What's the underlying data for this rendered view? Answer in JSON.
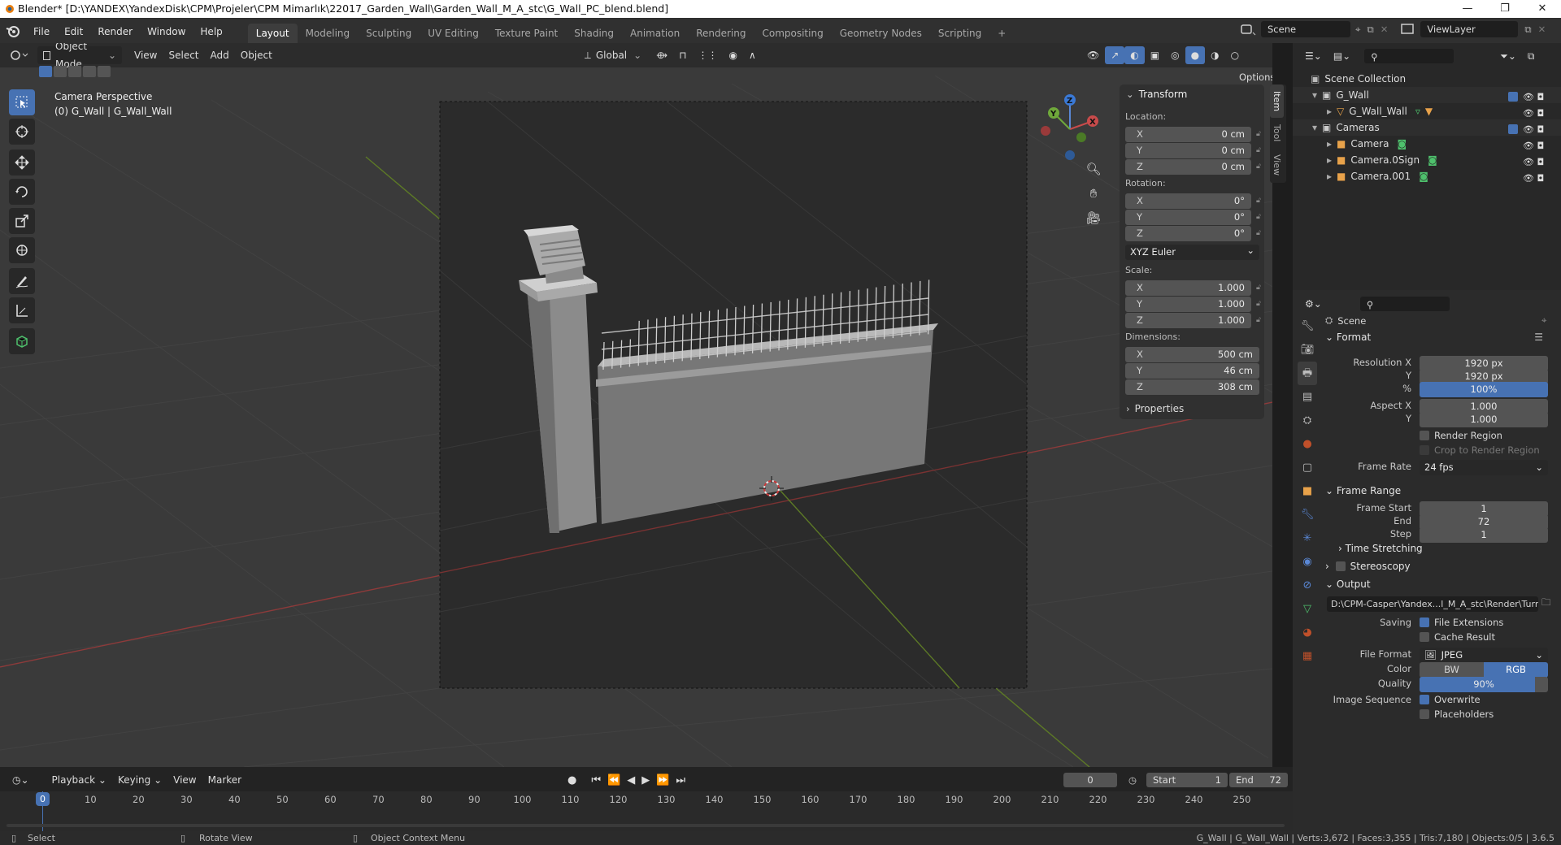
{
  "window": {
    "title": "Blender* [D:\\YANDEX\\YandexDisk\\CPM\\Projeler\\CPM Mimarlık\\22017_Garden_Wall\\Garden_Wall_M_A_stc\\G_Wall_PC_blend.blend]"
  },
  "menus": [
    "File",
    "Edit",
    "Render",
    "Window",
    "Help"
  ],
  "workspace_tabs": [
    "Layout",
    "Modeling",
    "Sculpting",
    "UV Editing",
    "Texture Paint",
    "Shading",
    "Animation",
    "Rendering",
    "Compositing",
    "Geometry Nodes",
    "Scripting"
  ],
  "active_tab": "Layout",
  "scene_name": "Scene",
  "view_layer": "ViewLayer",
  "viewport": {
    "mode": "Object Mode",
    "menus": [
      "View",
      "Select",
      "Add",
      "Object"
    ],
    "orientation": "Global",
    "options_label": "Options",
    "overlay_line1": "Camera Perspective",
    "overlay_line2": "(0) G_Wall | G_Wall_Wall"
  },
  "n_panel": {
    "header": "Transform",
    "location_label": "Location:",
    "location": [
      {
        "axis": "X",
        "value": "0 cm"
      },
      {
        "axis": "Y",
        "value": "0 cm"
      },
      {
        "axis": "Z",
        "value": "0 cm"
      }
    ],
    "rotation_label": "Rotation:",
    "rotation": [
      {
        "axis": "X",
        "value": "0°"
      },
      {
        "axis": "Y",
        "value": "0°"
      },
      {
        "axis": "Z",
        "value": "0°"
      }
    ],
    "rotation_mode": "XYZ Euler",
    "scale_label": "Scale:",
    "scale": [
      {
        "axis": "X",
        "value": "1.000"
      },
      {
        "axis": "Y",
        "value": "1.000"
      },
      {
        "axis": "Z",
        "value": "1.000"
      }
    ],
    "dimensions_label": "Dimensions:",
    "dimensions": [
      {
        "axis": "X",
        "value": "500 cm"
      },
      {
        "axis": "Y",
        "value": "46 cm"
      },
      {
        "axis": "Z",
        "value": "308 cm"
      }
    ],
    "properties_label": "Properties",
    "side_tabs": [
      "Item",
      "Tool",
      "View"
    ]
  },
  "outliner": {
    "root": "Scene Collection",
    "rows": [
      {
        "name": "G_Wall",
        "level": 0
      },
      {
        "name": "G_Wall_Wall",
        "level": 1
      },
      {
        "name": "Cameras",
        "level": 0
      },
      {
        "name": "Camera",
        "level": 1
      },
      {
        "name": "Camera.0Sign",
        "level": 1
      },
      {
        "name": "Camera.001",
        "level": 1
      }
    ]
  },
  "properties": {
    "context": "Scene",
    "format_header": "Format",
    "resolution_x_label": "Resolution X",
    "resolution_x": "1920 px",
    "resolution_y_label": "Y",
    "resolution_y": "1920 px",
    "percent_label": "%",
    "percent": "100%",
    "percent_value": 1.0,
    "aspect_x_label": "Aspect X",
    "aspect_x": "1.000",
    "aspect_y_label": "Y",
    "aspect_y": "1.000",
    "render_region": "Render Region",
    "crop_region": "Crop to Render Region",
    "frame_rate_label": "Frame Rate",
    "frame_rate": "24 fps",
    "frame_range_header": "Frame Range",
    "frame_start_label": "Frame Start",
    "frame_start": "1",
    "end_label": "End",
    "end": "72",
    "step_label": "Step",
    "step": "1",
    "time_stretching": "Time Stretching",
    "stereoscopy": "Stereoscopy",
    "output_header": "Output",
    "output_path": "D:\\CPM-Casper\\Yandex...l_M_A_stc\\Render\\Turn\\",
    "saving_label": "Saving",
    "file_extensions": "File Extensions",
    "cache_result": "Cache Result",
    "file_format_label": "File Format",
    "file_format": "JPEG",
    "color_label": "Color",
    "color_bw": "BW",
    "color_rgb": "RGB",
    "quality_label": "Quality",
    "quality": "90%",
    "quality_value": 0.9,
    "image_sequence_label": "Image Sequence",
    "overwrite": "Overwrite",
    "placeholders": "Placeholders"
  },
  "timeline": {
    "menus": [
      "Playback",
      "Keying",
      "View",
      "Marker"
    ],
    "current_frame": "0",
    "start_label": "Start",
    "start": "1",
    "end_label": "End",
    "end": "72",
    "ruler": [
      "0",
      "10",
      "20",
      "30",
      "40",
      "50",
      "60",
      "70",
      "80",
      "90",
      "100",
      "110",
      "120",
      "130",
      "140",
      "150",
      "160",
      "170",
      "180",
      "190",
      "200",
      "210",
      "220",
      "230",
      "240",
      "250"
    ]
  },
  "statusbar": {
    "select": "Select",
    "rotate": "Rotate View",
    "context_menu": "Object Context Menu",
    "stats": "G_Wall | G_Wall_Wall | Verts:3,672 | Faces:3,355 | Tris:7,180 | Objects:0/5 | 3.6.5"
  },
  "colors": {
    "accent": "#4772b3",
    "bg": "#303030",
    "viewport": "#3a3a3a",
    "x_axis": "#a23a3a",
    "y_axis": "#6c8d2c"
  }
}
